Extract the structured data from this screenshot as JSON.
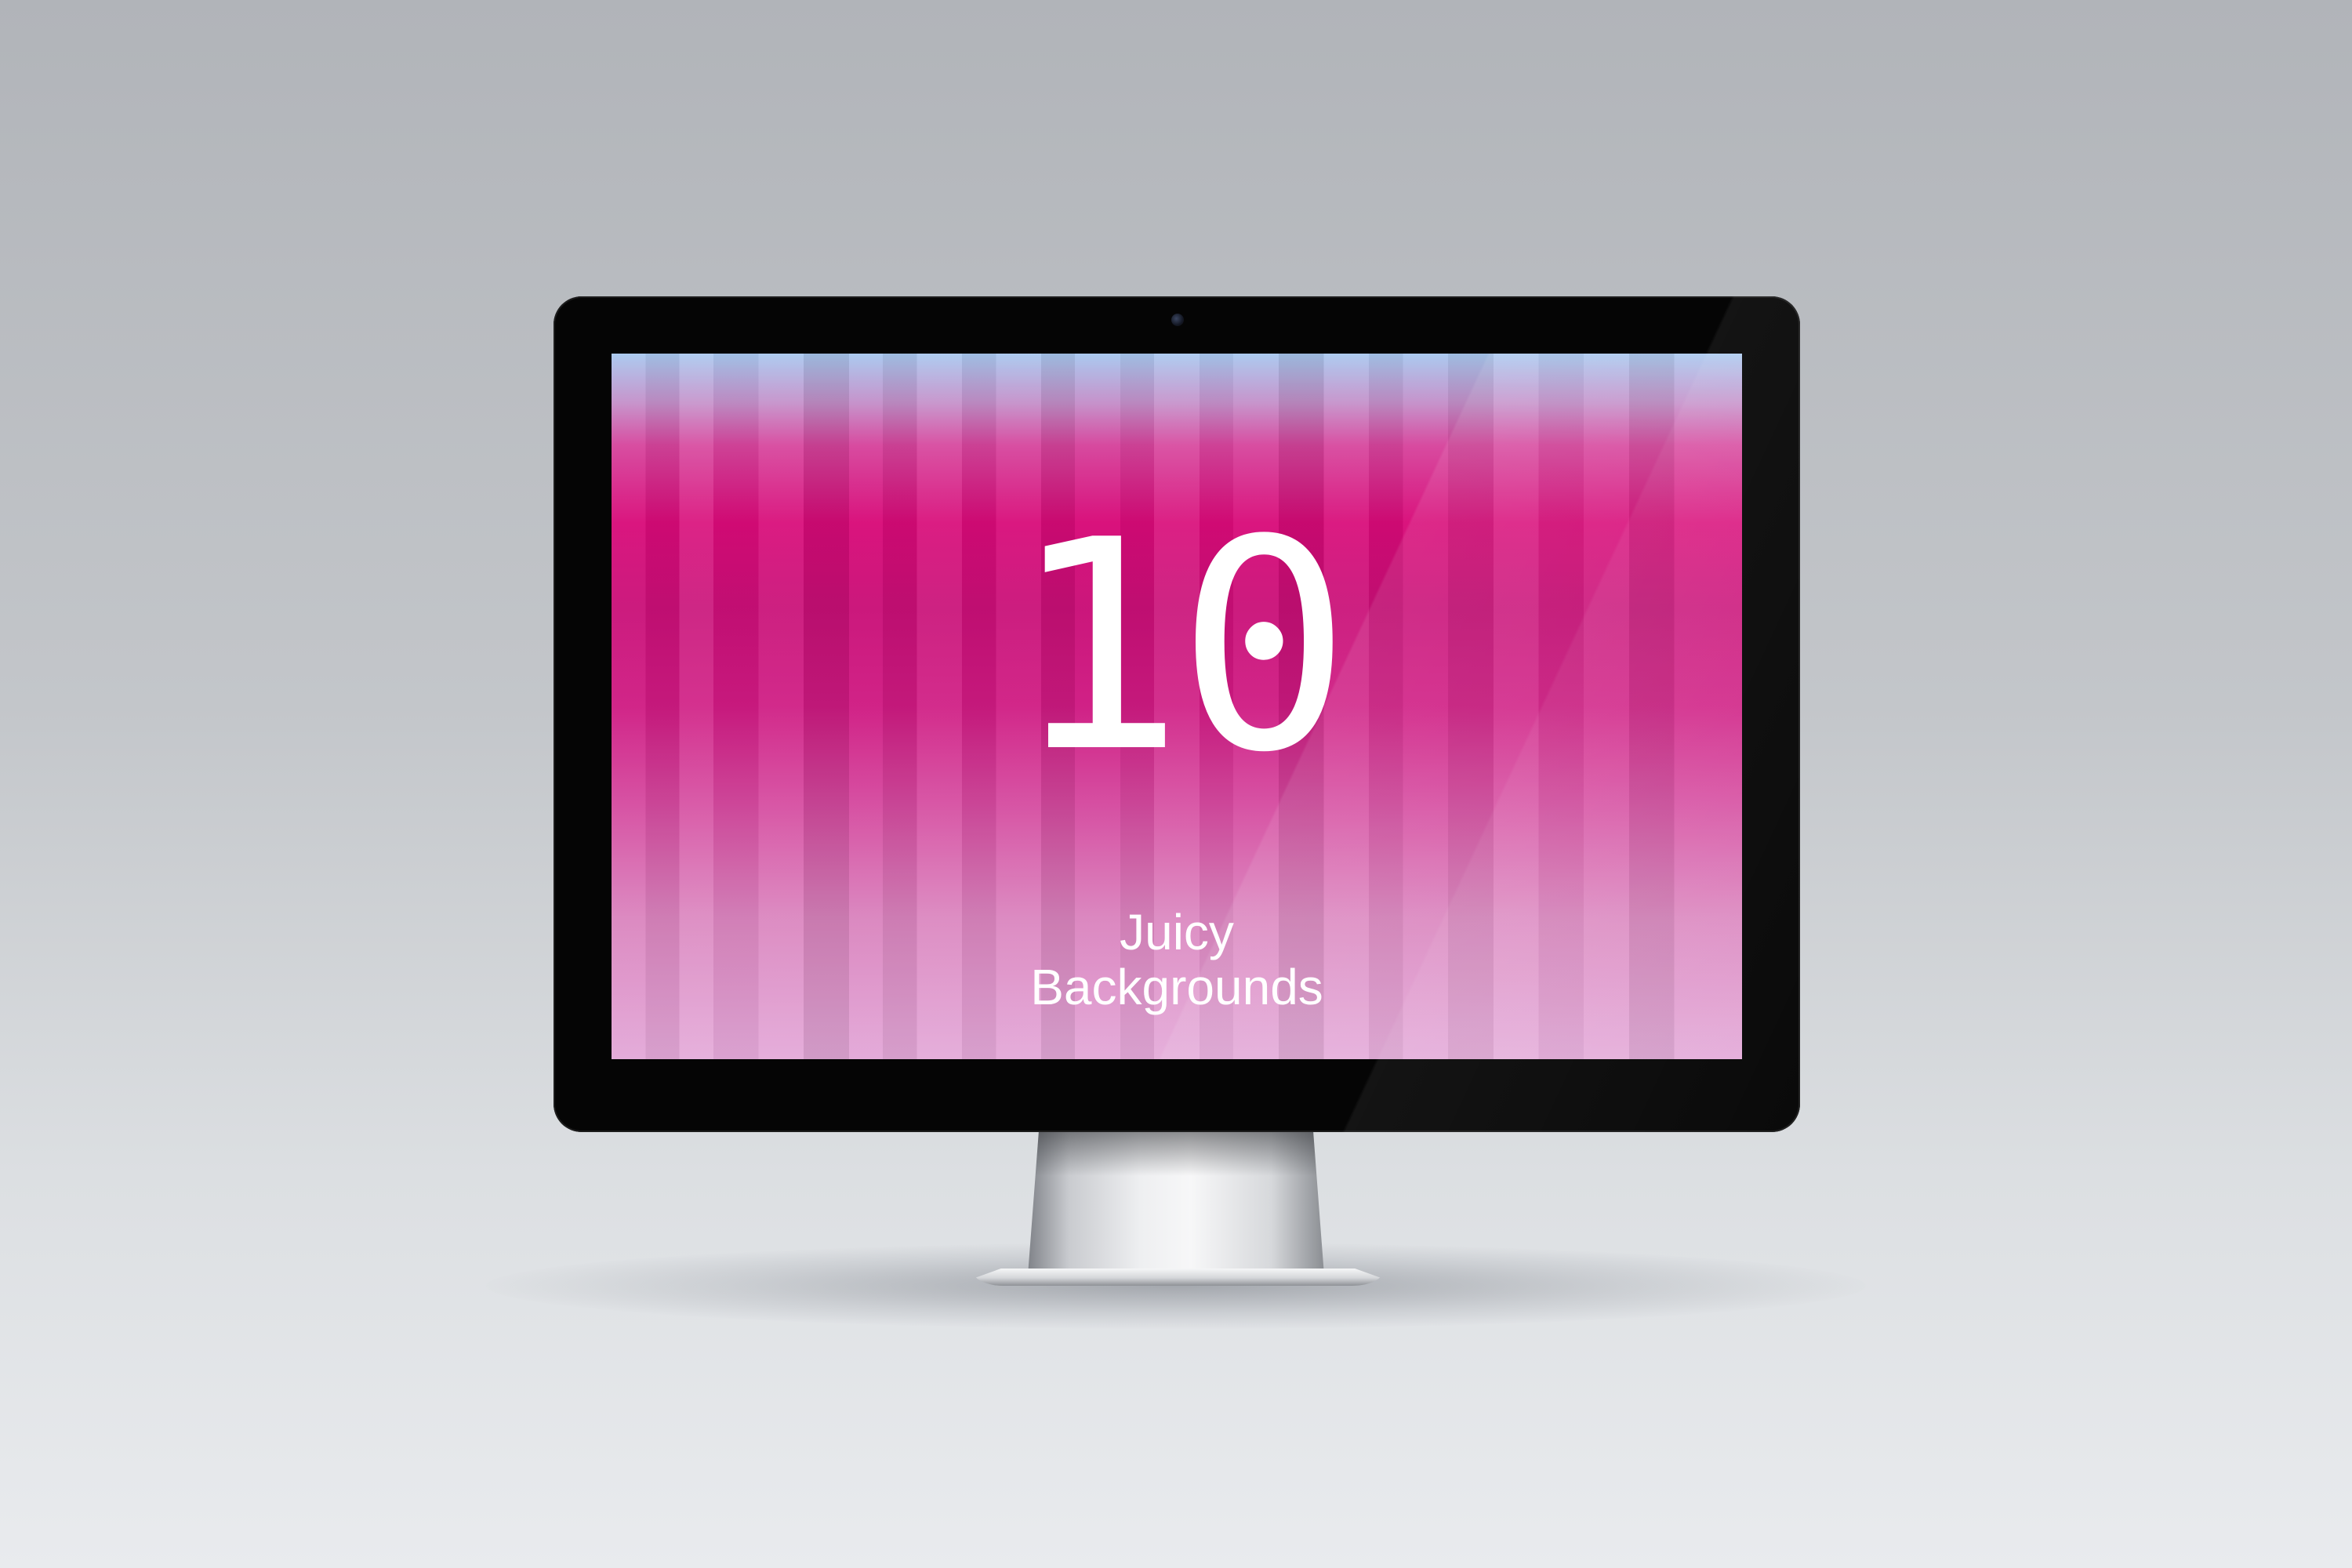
{
  "screen": {
    "headline": "10",
    "subtitle_line1": "Juicy",
    "subtitle_line2": "Backgrounds"
  },
  "colors": {
    "background_top": "#b1b4b9",
    "background_bottom": "#e9ebee",
    "bezel": "#050505",
    "screen_accent": "#d80a78",
    "screen_top": "#a8c8ef",
    "screen_bottom": "#e3a8d8",
    "text": "#ffffff"
  },
  "icons": {
    "camera": "camera-icon"
  }
}
